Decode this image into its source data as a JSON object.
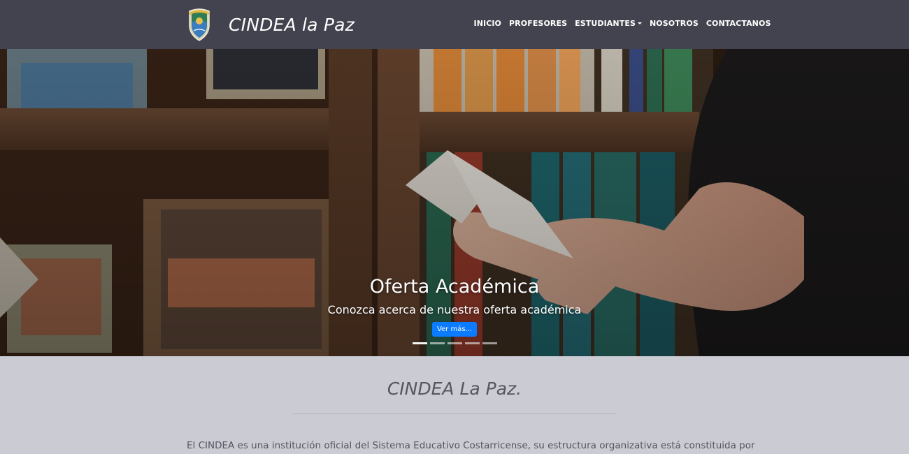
{
  "navbar": {
    "brand": "CINDEA la Paz",
    "items": [
      {
        "label": "INICIO"
      },
      {
        "label": "PROFESORES"
      },
      {
        "label": "ESTUDIANTES",
        "dropdown": true
      },
      {
        "label": "NOSOTROS"
      },
      {
        "label": "CONTACTANOS"
      }
    ]
  },
  "hero": {
    "title": "Oferta Académica",
    "subtitle": "Conozca acerca de nuestra oferta académica",
    "button_label": "Ver más...",
    "slide_count": 5,
    "active_slide": 1
  },
  "about": {
    "title": "CINDEA La Paz.",
    "text": "El CINDEA es una institución oficial del Sistema Educativo Costarricense, su estructura organizativa está constituida por"
  },
  "colors": {
    "navbar_bg": "#43434f",
    "section_bg": "#cbcbd4",
    "button_bg": "#0b7bff"
  },
  "icons": [
    "school-crest-logo-icon",
    "dropdown-caret-icon"
  ]
}
